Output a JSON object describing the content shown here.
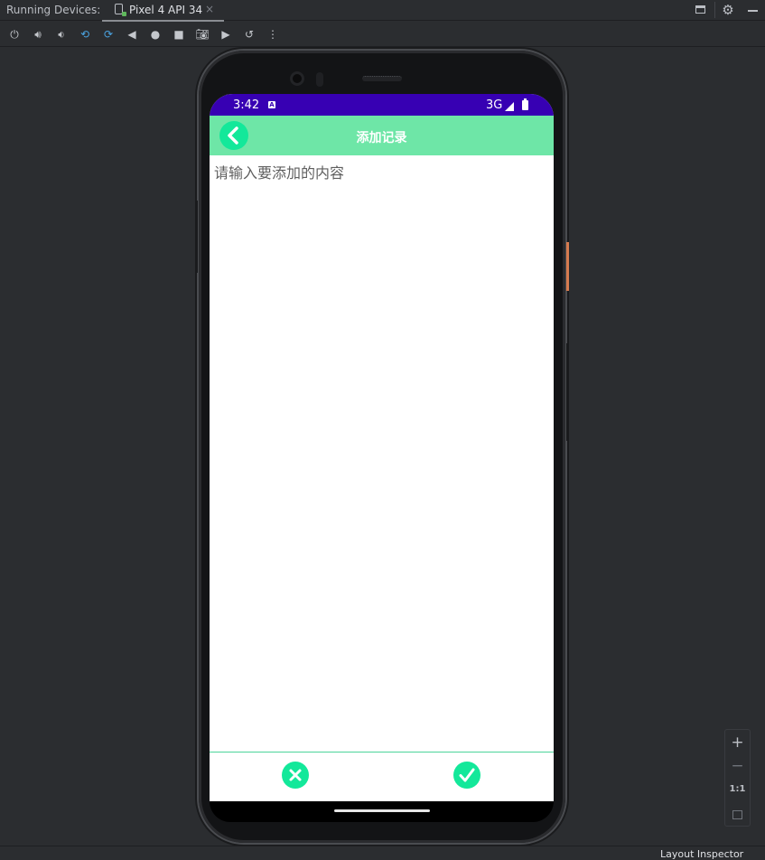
{
  "tool_window": {
    "title": "Running Devices:",
    "tab_label": "Pixel 4 API 34",
    "tab_close": "×"
  },
  "toolbar": {
    "icons": [
      "power-icon",
      "volume-up-icon",
      "volume-down-icon",
      "rotate-left-icon",
      "rotate-right-icon",
      "back-icon",
      "home-icon",
      "overview-icon",
      "screenshot-icon",
      "screen-record-icon",
      "reset-icon",
      "more-icon"
    ]
  },
  "device": {
    "status_bar": {
      "time": "3:42",
      "app_badge": "A",
      "network": "3G",
      "color": "#3700b3"
    },
    "app_bar": {
      "title": "添加记录",
      "color": "#6ee6a7"
    },
    "editor": {
      "placeholder": "请输入要添加的内容"
    },
    "accent_color": "#13e89a"
  },
  "zoom_controls": {
    "zoom_in": "+",
    "zoom_out": "−",
    "actual_size": "1:1"
  },
  "footer": {
    "layout_inspector": "Layout Inspector"
  }
}
